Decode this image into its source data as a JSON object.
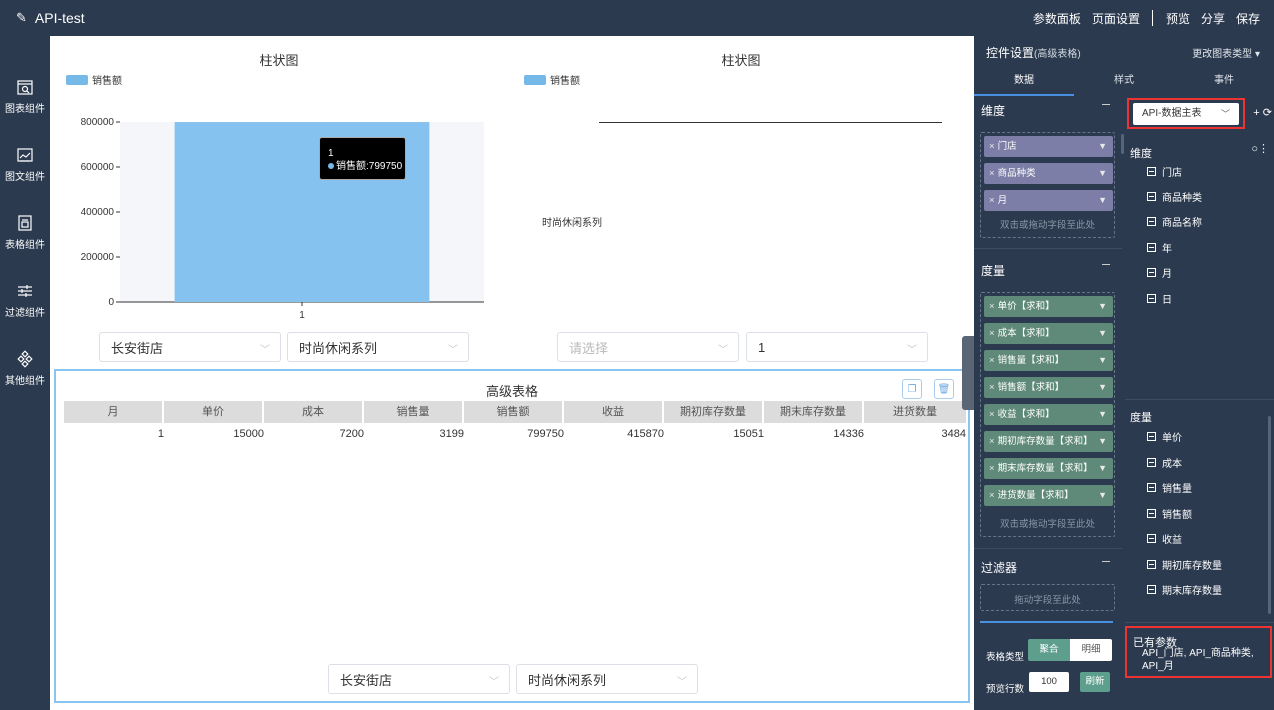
{
  "app": {
    "title": "API-test"
  },
  "topbar": {
    "params_panel": "参数面板",
    "page_settings": "页面设置",
    "preview": "预览",
    "share": "分享",
    "save": "保存"
  },
  "leftnav": [
    {
      "label": "图表组件",
      "icon": "chart-component-icon"
    },
    {
      "label": "图文组件",
      "icon": "image-text-icon"
    },
    {
      "label": "表格组件",
      "icon": "table-component-icon"
    },
    {
      "label": "过滤组件",
      "icon": "filter-component-icon"
    },
    {
      "label": "其他组件",
      "icon": "other-component-icon"
    }
  ],
  "chart1": {
    "title": "柱状图",
    "legend": "销售额",
    "tooltip": {
      "x": "1",
      "label": "销售额:799750"
    },
    "filters": [
      "长安街店",
      "时尚休闲系列"
    ]
  },
  "chart2": {
    "title": "柱状图",
    "legend": "销售额",
    "series_label": "时尚休闲系列",
    "filters": {
      "placeholder": "请选择",
      "value": "1"
    }
  },
  "chart_data": {
    "type": "bar",
    "categories": [
      "1"
    ],
    "series": [
      {
        "name": "销售额",
        "values": [
          799750
        ]
      }
    ],
    "yticks": [
      "800000",
      "600000",
      "400000",
      "200000",
      "0"
    ],
    "ylim": [
      0,
      800000
    ]
  },
  "table": {
    "title": "高级表格",
    "headers": [
      "月",
      "单价",
      "成本",
      "销售量",
      "销售额",
      "收益",
      "期初库存数量",
      "期末库存数量",
      "进货数量"
    ],
    "rows": [
      [
        "1",
        "15000",
        "7200",
        "3199",
        "799750",
        "415870",
        "15051",
        "14336",
        "3484"
      ]
    ],
    "filters": [
      "长安街店",
      "时尚休闲系列"
    ]
  },
  "controls": {
    "header": "控件设置",
    "header_sub": "(高级表格)",
    "change_type": "更改图表类型",
    "tabs": [
      "数据",
      "样式",
      "事件"
    ],
    "dimension_label": "维度",
    "dimensions": [
      "门店",
      "商品种类",
      "月"
    ],
    "dimension_hint": "双击或拖动字段至此处",
    "measure_label": "度量",
    "measures": [
      "单价【求和】",
      "成本【求和】",
      "销售量【求和】",
      "销售额【求和】",
      "收益【求和】",
      "期初库存数量【求和】",
      "期末库存数量【求和】",
      "进货数量【求和】"
    ],
    "measure_hint": "双击或拖动字段至此处",
    "filter_label": "过滤器",
    "filter_hint": "拖动字段至此处",
    "table_type_label": "表格类型",
    "table_type_options": [
      "聚合",
      "明细"
    ],
    "preview_rows_label": "预览行数",
    "preview_rows": "100",
    "refresh": "刷新"
  },
  "source": {
    "dataset": "API-数据主表",
    "dim_label": "维度",
    "dims": [
      "门店",
      "商品种类",
      "商品名称",
      "年",
      "月",
      "日"
    ],
    "mea_label": "度量",
    "meas": [
      "单价",
      "成本",
      "销售量",
      "销售额",
      "收益",
      "期初库存数量",
      "期末库存数量"
    ],
    "params_title": "已有参数",
    "params_value": "API_门店, API_商品种类, API_月"
  },
  "colors": {
    "bar": "#86c2f0",
    "accent": "#4a90e2",
    "highlight": "#e33333"
  }
}
